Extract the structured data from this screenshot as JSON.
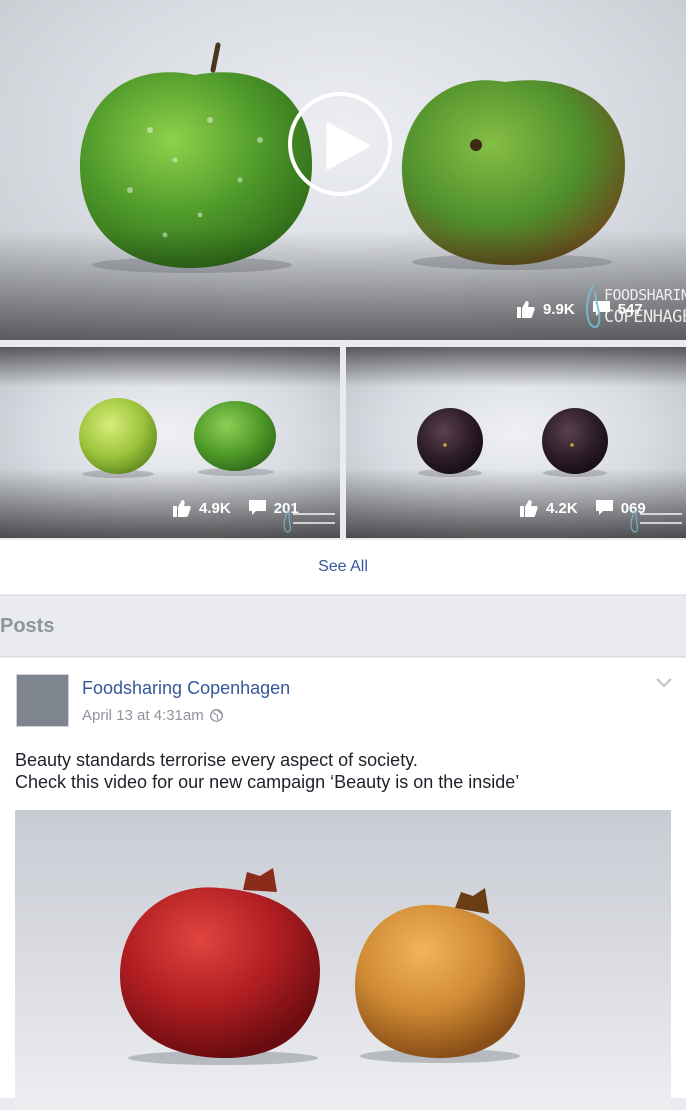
{
  "featured_video": {
    "likes": "9.9K",
    "comments": "547",
    "watermark_line1": "FOODSHARING",
    "watermark_line2": "COPENHAGEN"
  },
  "thumbnails": [
    {
      "likes": "4.9K",
      "comments": "201"
    },
    {
      "likes": "4.2K",
      "comments": "069"
    }
  ],
  "see_all_label": "See All",
  "posts_header": "Posts",
  "post": {
    "author": "Foodsharing Copenhagen",
    "date": "April 13 at 4:31am",
    "text_line1": "Beauty standards terrorise every aspect of society.",
    "text_line2": "Check this video for our new campaign ‘Beauty is on the inside’"
  },
  "colors": {
    "link_blue": "#365899",
    "page_bg": "#e9ebee",
    "secondary_text": "#90949c"
  },
  "icons": [
    "play-icon",
    "like-icon",
    "comment-icon",
    "globe-icon",
    "chevron-down-icon"
  ]
}
